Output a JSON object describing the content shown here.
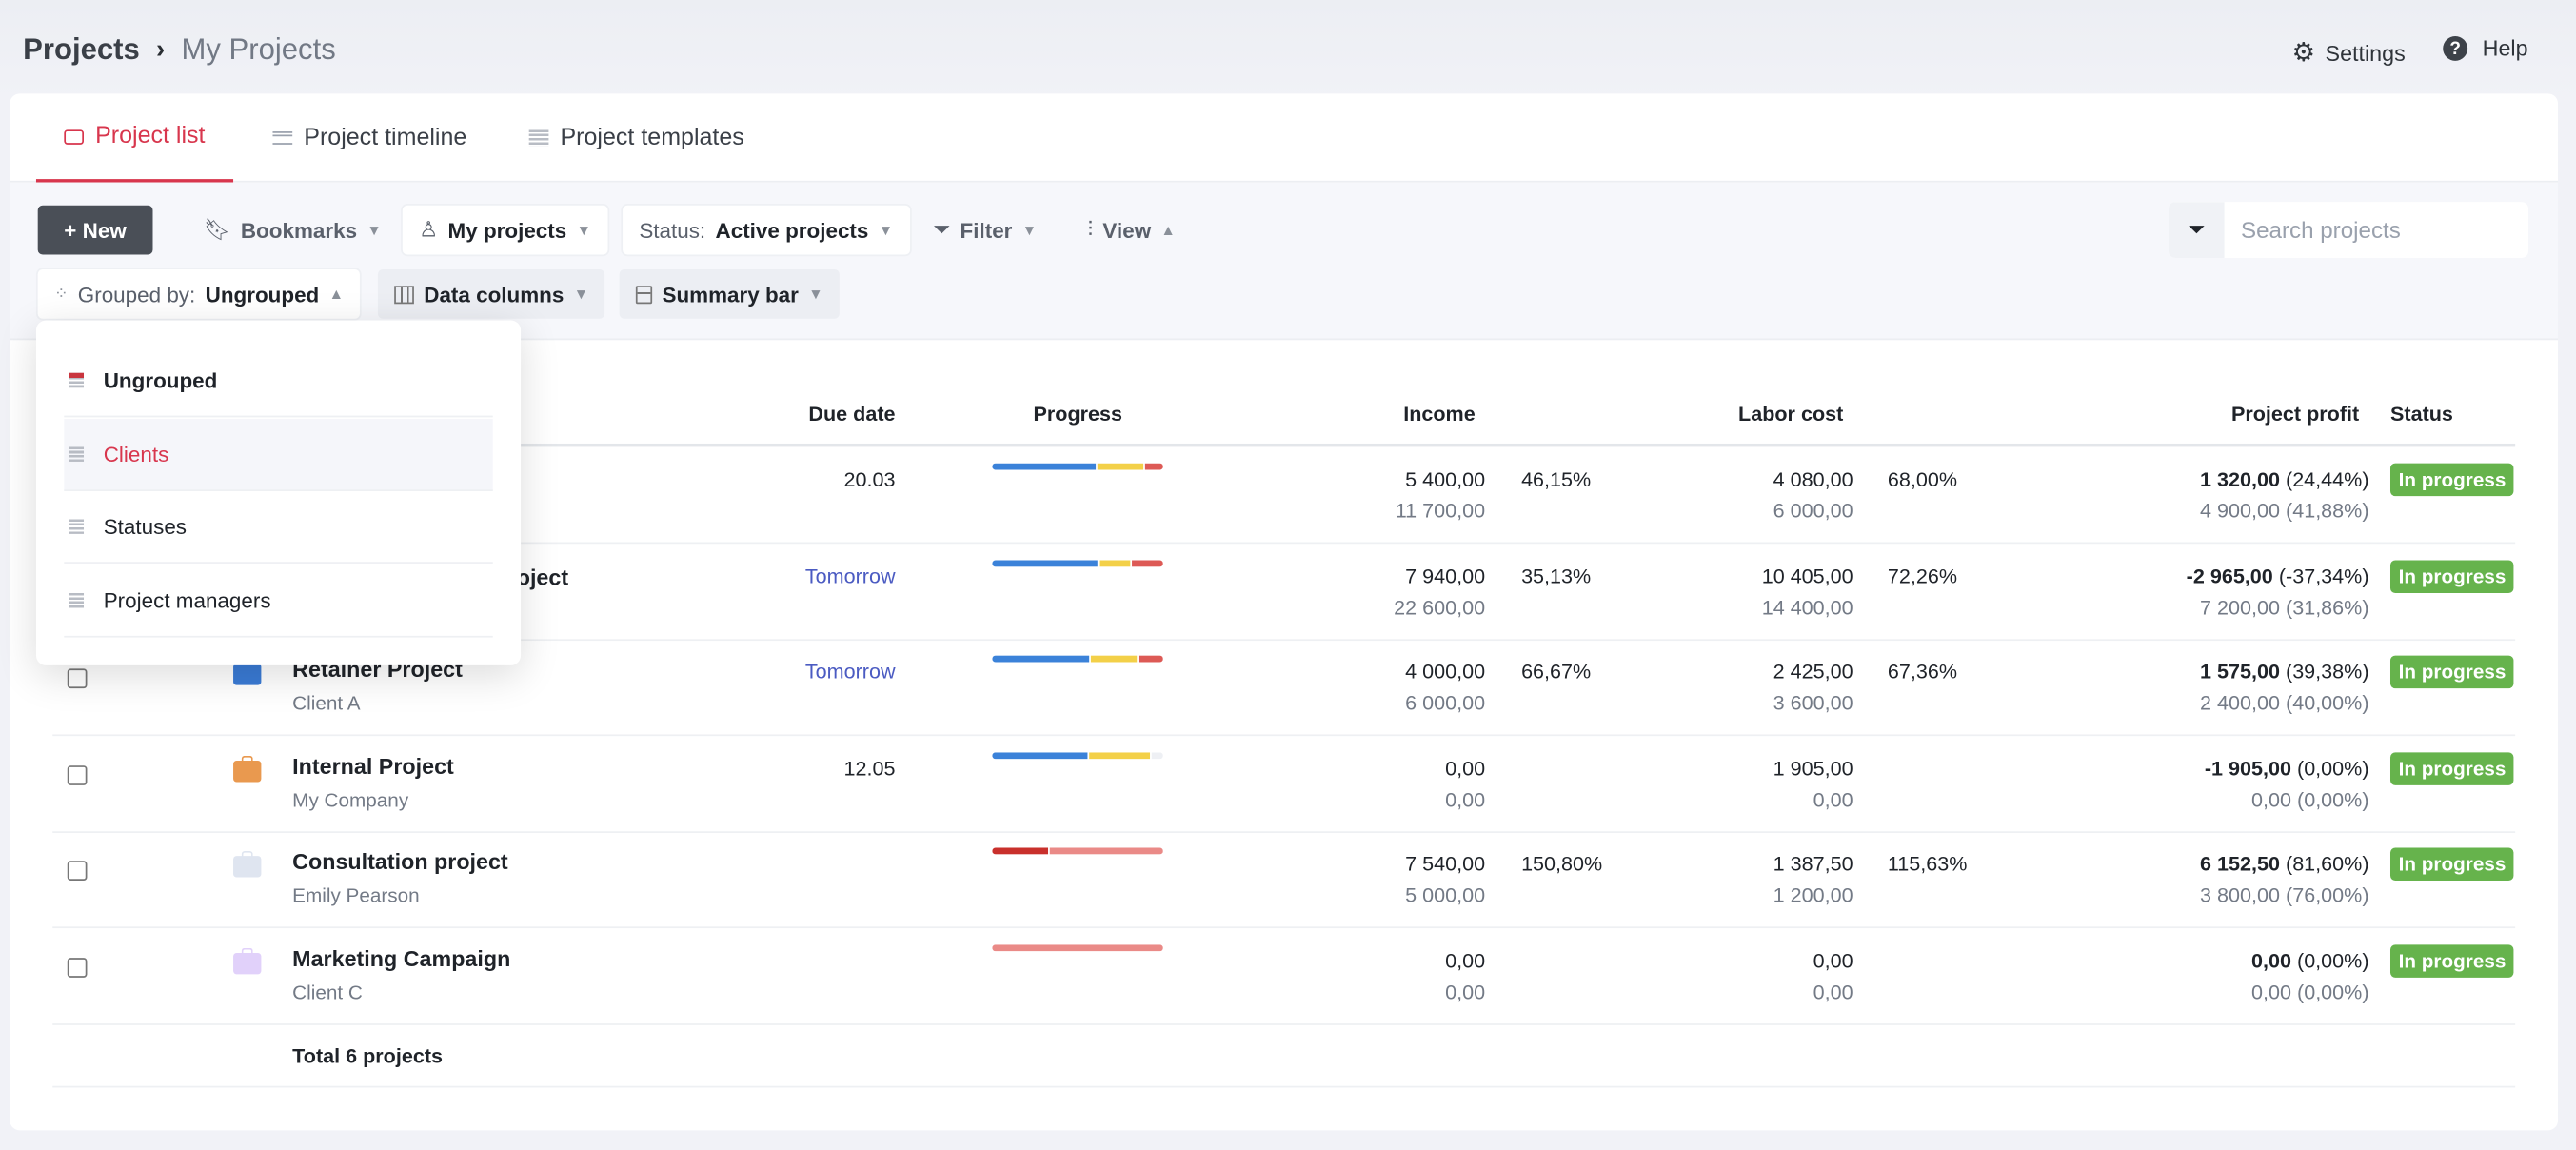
{
  "breadcrumb": {
    "root": "Projects",
    "current": "My Projects"
  },
  "top_actions": {
    "settings": "Settings",
    "help": "Help"
  },
  "tabs": [
    {
      "label": "Project list",
      "active": true
    },
    {
      "label": "Project timeline"
    },
    {
      "label": "Project templates"
    }
  ],
  "toolbar": {
    "new": "+ New",
    "bookmarks": "Bookmarks",
    "my_projects": "My projects",
    "status_prefix": "Status:",
    "status_value": "Active projects",
    "filter": "Filter",
    "view": "View",
    "grouped_prefix": "Grouped by:",
    "grouped_value": "Ungrouped",
    "data_columns": "Data columns",
    "summary_bar": "Summary bar",
    "search_placeholder": "Search projects"
  },
  "group_menu": {
    "items": [
      {
        "label": "Ungrouped",
        "selected": true
      },
      {
        "label": "Clients",
        "hover": true
      },
      {
        "label": "Statuses"
      },
      {
        "label": "Project managers"
      }
    ]
  },
  "table": {
    "headers": {
      "due": "Due date",
      "progress": "Progress",
      "income": "Income",
      "labor": "Labor cost",
      "profit": "Project profit",
      "status": "Status"
    },
    "rows": [
      {
        "name": "",
        "client": "",
        "color": "#3d7fd9",
        "due": "20.03",
        "due_soon": false,
        "progress": [
          [
            62,
            "#3b82d9"
          ],
          [
            27,
            "#f3d048"
          ],
          [
            11,
            "#dd5a55"
          ]
        ],
        "income": "5 400,00",
        "income_pct": "46,15%",
        "income_sub": "11 700,00",
        "labor": "4 080,00",
        "labor_pct": "68,00%",
        "labor_sub": "6 000,00",
        "profit": "1 320,00",
        "profit_pct": "(24,44%)",
        "profit_sub": "4 900,00 (41,88%)",
        "status": "In progress"
      },
      {
        "name": "oject",
        "client": "",
        "color": "#3d7fd9",
        "due": "Tomorrow",
        "due_soon": true,
        "progress": [
          [
            63,
            "#3b82d9"
          ],
          [
            18,
            "#f3d048"
          ],
          [
            19,
            "#dd5a55"
          ]
        ],
        "income": "7 940,00",
        "income_pct": "35,13%",
        "income_sub": "22 600,00",
        "labor": "10 405,00",
        "labor_pct": "72,26%",
        "labor_sub": "14 400,00",
        "profit": "-2 965,00",
        "profit_pct": "(-37,34%)",
        "profit_sub": "7 200,00 (31,86%)",
        "status": "In progress"
      },
      {
        "name": "Retainer Project",
        "client": "Client A",
        "color": "#3a7bd5",
        "due": "Tomorrow",
        "due_soon": true,
        "progress": [
          [
            58,
            "#3b82d9"
          ],
          [
            27,
            "#f3d048"
          ],
          [
            15,
            "#dd5a55"
          ]
        ],
        "income": "4 000,00",
        "income_pct": "66,67%",
        "income_sub": "6 000,00",
        "labor": "2 425,00",
        "labor_pct": "67,36%",
        "labor_sub": "3 600,00",
        "profit": "1 575,00",
        "profit_pct": "(39,38%)",
        "profit_sub": "2 400,00 (40,00%)",
        "status": "In progress"
      },
      {
        "name": "Internal Project",
        "client": "My Company",
        "color": "#e9994f",
        "due": "12.05",
        "due_soon": false,
        "progress": [
          [
            57,
            "#3b82d9"
          ],
          [
            36,
            "#f3d048"
          ],
          [
            7,
            "#eef0f4"
          ]
        ],
        "income": "0,00",
        "income_pct": "",
        "income_sub": "0,00",
        "labor": "1 905,00",
        "labor_pct": "",
        "labor_sub": "0,00",
        "profit": "-1 905,00",
        "profit_pct": "(0,00%)",
        "profit_sub": "0,00 (0,00%)",
        "status": "In progress"
      },
      {
        "name": "Consultation project",
        "client": "Emily Pearson",
        "color": "#dfe5f0",
        "due": "",
        "due_soon": false,
        "progress": [
          [
            33,
            "#c9302c"
          ],
          [
            67,
            "#ea8a87"
          ]
        ],
        "income": "7 540,00",
        "income_pct": "150,80%",
        "income_sub": "5 000,00",
        "labor": "1 387,50",
        "labor_pct": "115,63%",
        "labor_sub": "1 200,00",
        "profit": "6 152,50",
        "profit_pct": "(81,60%)",
        "profit_sub": "3 800,00 (76,00%)",
        "status": "In progress"
      },
      {
        "name": "Marketing Campaign",
        "client": "Client C",
        "color": "#e1d1fa",
        "due": "",
        "due_soon": false,
        "progress": [
          [
            100,
            "#ea8a87"
          ]
        ],
        "income": "0,00",
        "income_pct": "",
        "income_sub": "0,00",
        "labor": "0,00",
        "labor_pct": "",
        "labor_sub": "0,00",
        "profit": "0,00",
        "profit_pct": "(0,00%)",
        "profit_sub": "0,00 (0,00%)",
        "status": "In progress"
      }
    ],
    "total": "Total 6 projects"
  },
  "colors": {
    "accent": "#d8364d",
    "status_green": "#66b34c",
    "link": "#4b5bc2"
  }
}
